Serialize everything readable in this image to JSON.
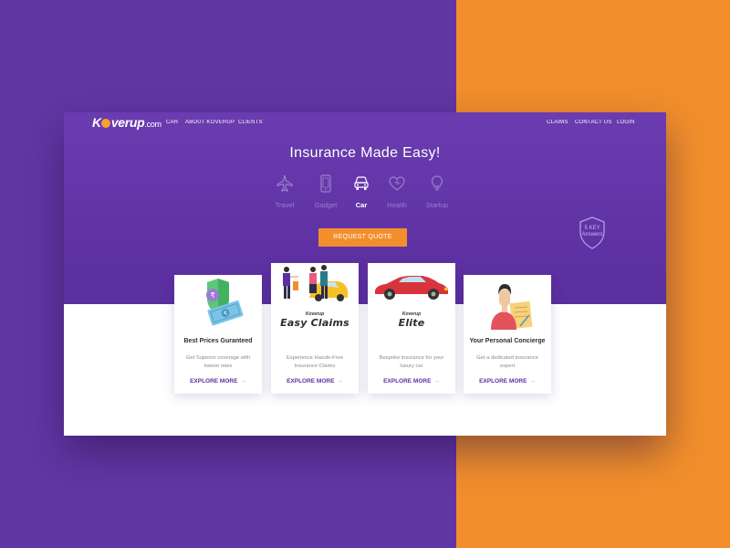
{
  "brand": {
    "name_pre": "K",
    "name_post": "verup",
    "domain": ".com"
  },
  "nav": {
    "left": [
      "CAR",
      "ABOUT KOVERUP",
      "CLIENTS"
    ],
    "right": [
      "CLAIMS",
      "CONTACT US",
      "LOGIN"
    ]
  },
  "hero": {
    "title": "Insurance Made Easy!"
  },
  "categories": [
    {
      "label": "Travel",
      "icon": "airplane-icon",
      "active": false
    },
    {
      "label": "Gadget",
      "icon": "phone-icon",
      "active": false
    },
    {
      "label": "Car",
      "icon": "car-icon",
      "active": true
    },
    {
      "label": "Health",
      "icon": "heart-icon",
      "active": false
    },
    {
      "label": "Startup",
      "icon": "lightbulb-icon",
      "active": false
    }
  ],
  "cta": {
    "label": "REQUEST QUOTE"
  },
  "key_badge": {
    "line1": "5 KEY",
    "line2": "Answers"
  },
  "cards": [
    {
      "title": "Best Prices Guranteed",
      "desc": "Get Superior coverage with lowest rates",
      "link": "EXPLORE MORE",
      "icon": "money-shield-icon"
    },
    {
      "brand_small": "Koverup",
      "brand_big": "Easy Claims",
      "desc": "Experience Hassle-Free Insurance Claims",
      "link": "EXPLORE MORE",
      "icon": "people-car-icon"
    },
    {
      "brand_small": "Koverup",
      "brand_big": "Elite",
      "desc": "Bespoke insurance for your luxury car",
      "link": "EXPLORE MORE",
      "icon": "red-sports-car-icon"
    },
    {
      "title": "Your Personal Concierge",
      "desc": "Get a dedicated insurance expert",
      "link": "EXPLORE MORE",
      "icon": "concierge-person-icon"
    }
  ],
  "colors": {
    "purple": "#6236a4",
    "orange": "#f28f2c",
    "link": "#5b2fa3"
  }
}
